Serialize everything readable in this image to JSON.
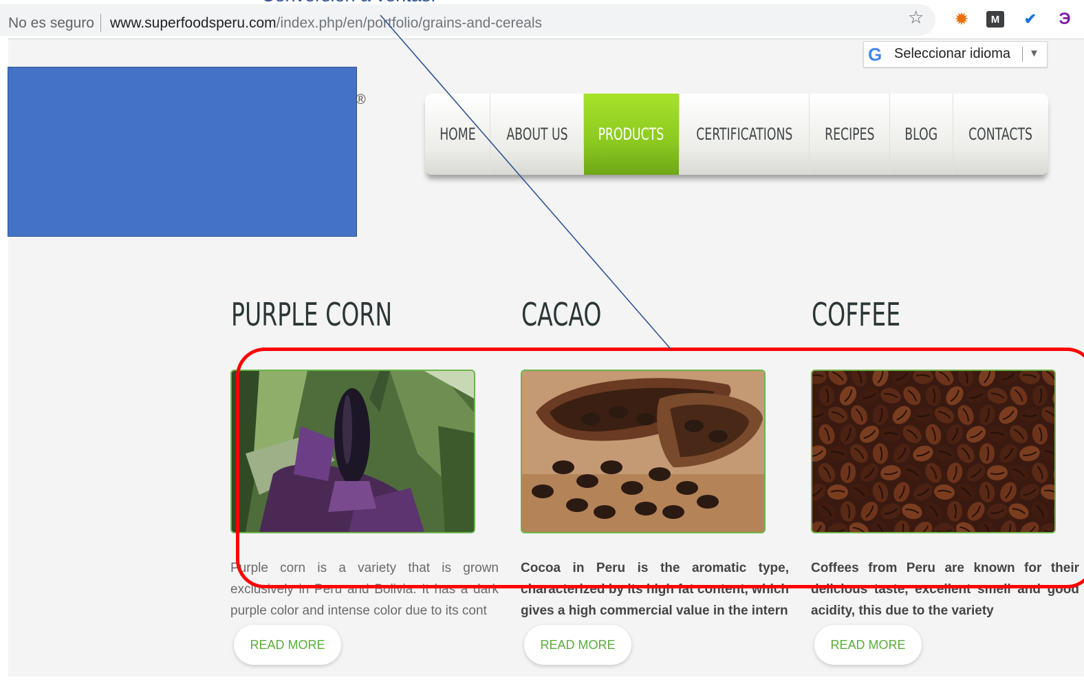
{
  "slide": {
    "caption_fragment": "Conversión a ventas."
  },
  "browser": {
    "security_label": "No es seguro",
    "url_host": "www.superfoodsperu.com",
    "url_path": "/index.php/en/portfolio/grains-and-cereals",
    "bookmark_icon": "star-icon",
    "extension_icons": [
      "extension-icon",
      "m-extension-icon",
      "check-extension-icon",
      "e-extension-icon"
    ]
  },
  "translate_widget": {
    "label": "Seleccionar idioma",
    "logo_letter": "G"
  },
  "logo": {
    "registered_mark": "®",
    "redaction_color": "#4472c4"
  },
  "nav": {
    "items": [
      {
        "label": "HOME",
        "active": false
      },
      {
        "label": "ABOUT US",
        "active": false
      },
      {
        "label": "PRODUCTS",
        "active": true
      },
      {
        "label": "CERTIFICATIONS",
        "active": false
      },
      {
        "label": "RECIPES",
        "active": false
      },
      {
        "label": "BLOG",
        "active": false
      },
      {
        "label": "CONTACTS",
        "active": false
      }
    ],
    "active_color": "#8cc920"
  },
  "products": [
    {
      "title": "PURPLE CORN",
      "image": "purple-corn-photo",
      "description": "Purple corn is a variety that is grown exclusively in Peru and Bolivia. It has a dark purple color and intense color due to its cont",
      "button": "READ MORE"
    },
    {
      "title": "CACAO",
      "image": "cacao-photo",
      "description": "Cocoa in Peru is the aromatic type, characterized by its high fat content, which gives a high commercial value in the intern",
      "button": "READ MORE"
    },
    {
      "title": "COFFEE",
      "image": "coffee-photo",
      "description": "Coffees from Peru are known for their delicious taste, excellent smell and good acidity, this due to the variety",
      "button": "READ MORE"
    }
  ],
  "annotation": {
    "highlight_color": "#ff0000",
    "pointer_color": "#2e5394"
  }
}
